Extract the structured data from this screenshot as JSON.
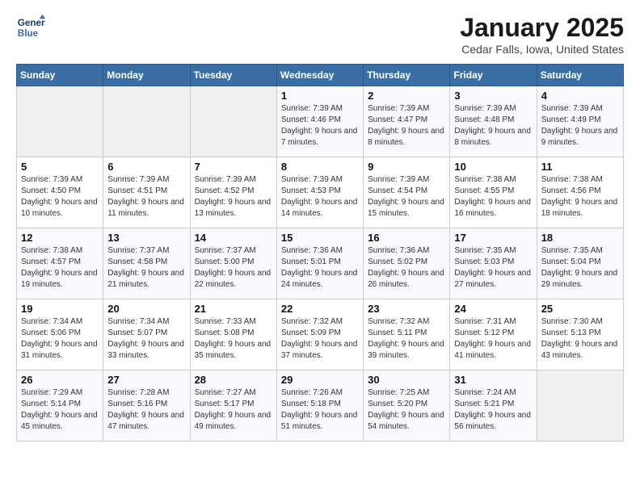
{
  "header": {
    "logo_line1": "General",
    "logo_line2": "Blue",
    "month": "January 2025",
    "location": "Cedar Falls, Iowa, United States"
  },
  "weekdays": [
    "Sunday",
    "Monday",
    "Tuesday",
    "Wednesday",
    "Thursday",
    "Friday",
    "Saturday"
  ],
  "weeks": [
    [
      {
        "day": "",
        "sunrise": "",
        "sunset": "",
        "daylight": ""
      },
      {
        "day": "",
        "sunrise": "",
        "sunset": "",
        "daylight": ""
      },
      {
        "day": "",
        "sunrise": "",
        "sunset": "",
        "daylight": ""
      },
      {
        "day": "1",
        "sunrise": "Sunrise: 7:39 AM",
        "sunset": "Sunset: 4:46 PM",
        "daylight": "Daylight: 9 hours and 7 minutes."
      },
      {
        "day": "2",
        "sunrise": "Sunrise: 7:39 AM",
        "sunset": "Sunset: 4:47 PM",
        "daylight": "Daylight: 9 hours and 8 minutes."
      },
      {
        "day": "3",
        "sunrise": "Sunrise: 7:39 AM",
        "sunset": "Sunset: 4:48 PM",
        "daylight": "Daylight: 9 hours and 8 minutes."
      },
      {
        "day": "4",
        "sunrise": "Sunrise: 7:39 AM",
        "sunset": "Sunset: 4:49 PM",
        "daylight": "Daylight: 9 hours and 9 minutes."
      }
    ],
    [
      {
        "day": "5",
        "sunrise": "Sunrise: 7:39 AM",
        "sunset": "Sunset: 4:50 PM",
        "daylight": "Daylight: 9 hours and 10 minutes."
      },
      {
        "day": "6",
        "sunrise": "Sunrise: 7:39 AM",
        "sunset": "Sunset: 4:51 PM",
        "daylight": "Daylight: 9 hours and 11 minutes."
      },
      {
        "day": "7",
        "sunrise": "Sunrise: 7:39 AM",
        "sunset": "Sunset: 4:52 PM",
        "daylight": "Daylight: 9 hours and 13 minutes."
      },
      {
        "day": "8",
        "sunrise": "Sunrise: 7:39 AM",
        "sunset": "Sunset: 4:53 PM",
        "daylight": "Daylight: 9 hours and 14 minutes."
      },
      {
        "day": "9",
        "sunrise": "Sunrise: 7:39 AM",
        "sunset": "Sunset: 4:54 PM",
        "daylight": "Daylight: 9 hours and 15 minutes."
      },
      {
        "day": "10",
        "sunrise": "Sunrise: 7:38 AM",
        "sunset": "Sunset: 4:55 PM",
        "daylight": "Daylight: 9 hours and 16 minutes."
      },
      {
        "day": "11",
        "sunrise": "Sunrise: 7:38 AM",
        "sunset": "Sunset: 4:56 PM",
        "daylight": "Daylight: 9 hours and 18 minutes."
      }
    ],
    [
      {
        "day": "12",
        "sunrise": "Sunrise: 7:38 AM",
        "sunset": "Sunset: 4:57 PM",
        "daylight": "Daylight: 9 hours and 19 minutes."
      },
      {
        "day": "13",
        "sunrise": "Sunrise: 7:37 AM",
        "sunset": "Sunset: 4:58 PM",
        "daylight": "Daylight: 9 hours and 21 minutes."
      },
      {
        "day": "14",
        "sunrise": "Sunrise: 7:37 AM",
        "sunset": "Sunset: 5:00 PM",
        "daylight": "Daylight: 9 hours and 22 minutes."
      },
      {
        "day": "15",
        "sunrise": "Sunrise: 7:36 AM",
        "sunset": "Sunset: 5:01 PM",
        "daylight": "Daylight: 9 hours and 24 minutes."
      },
      {
        "day": "16",
        "sunrise": "Sunrise: 7:36 AM",
        "sunset": "Sunset: 5:02 PM",
        "daylight": "Daylight: 9 hours and 26 minutes."
      },
      {
        "day": "17",
        "sunrise": "Sunrise: 7:35 AM",
        "sunset": "Sunset: 5:03 PM",
        "daylight": "Daylight: 9 hours and 27 minutes."
      },
      {
        "day": "18",
        "sunrise": "Sunrise: 7:35 AM",
        "sunset": "Sunset: 5:04 PM",
        "daylight": "Daylight: 9 hours and 29 minutes."
      }
    ],
    [
      {
        "day": "19",
        "sunrise": "Sunrise: 7:34 AM",
        "sunset": "Sunset: 5:06 PM",
        "daylight": "Daylight: 9 hours and 31 minutes."
      },
      {
        "day": "20",
        "sunrise": "Sunrise: 7:34 AM",
        "sunset": "Sunset: 5:07 PM",
        "daylight": "Daylight: 9 hours and 33 minutes."
      },
      {
        "day": "21",
        "sunrise": "Sunrise: 7:33 AM",
        "sunset": "Sunset: 5:08 PM",
        "daylight": "Daylight: 9 hours and 35 minutes."
      },
      {
        "day": "22",
        "sunrise": "Sunrise: 7:32 AM",
        "sunset": "Sunset: 5:09 PM",
        "daylight": "Daylight: 9 hours and 37 minutes."
      },
      {
        "day": "23",
        "sunrise": "Sunrise: 7:32 AM",
        "sunset": "Sunset: 5:11 PM",
        "daylight": "Daylight: 9 hours and 39 minutes."
      },
      {
        "day": "24",
        "sunrise": "Sunrise: 7:31 AM",
        "sunset": "Sunset: 5:12 PM",
        "daylight": "Daylight: 9 hours and 41 minutes."
      },
      {
        "day": "25",
        "sunrise": "Sunrise: 7:30 AM",
        "sunset": "Sunset: 5:13 PM",
        "daylight": "Daylight: 9 hours and 43 minutes."
      }
    ],
    [
      {
        "day": "26",
        "sunrise": "Sunrise: 7:29 AM",
        "sunset": "Sunset: 5:14 PM",
        "daylight": "Daylight: 9 hours and 45 minutes."
      },
      {
        "day": "27",
        "sunrise": "Sunrise: 7:28 AM",
        "sunset": "Sunset: 5:16 PM",
        "daylight": "Daylight: 9 hours and 47 minutes."
      },
      {
        "day": "28",
        "sunrise": "Sunrise: 7:27 AM",
        "sunset": "Sunset: 5:17 PM",
        "daylight": "Daylight: 9 hours and 49 minutes."
      },
      {
        "day": "29",
        "sunrise": "Sunrise: 7:26 AM",
        "sunset": "Sunset: 5:18 PM",
        "daylight": "Daylight: 9 hours and 51 minutes."
      },
      {
        "day": "30",
        "sunrise": "Sunrise: 7:25 AM",
        "sunset": "Sunset: 5:20 PM",
        "daylight": "Daylight: 9 hours and 54 minutes."
      },
      {
        "day": "31",
        "sunrise": "Sunrise: 7:24 AM",
        "sunset": "Sunset: 5:21 PM",
        "daylight": "Daylight: 9 hours and 56 minutes."
      },
      {
        "day": "",
        "sunrise": "",
        "sunset": "",
        "daylight": ""
      }
    ]
  ]
}
